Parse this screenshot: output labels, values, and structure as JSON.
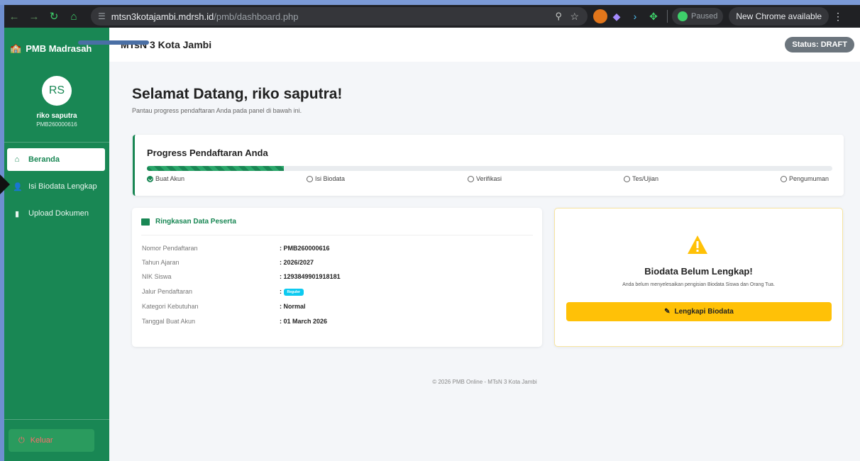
{
  "browser": {
    "url_host": "mtsn3kotajambi.mdrsh.id",
    "url_path": "/pmb/dashboard.php",
    "paused_label": "Paused",
    "update_label": "New Chrome available"
  },
  "sidebar": {
    "brand": "PMB Madrasah",
    "avatar_initials": "RS",
    "user_name": "riko saputra",
    "user_code": "PMB260000616",
    "items": [
      {
        "label": "Beranda",
        "active": true
      },
      {
        "label": "Isi Biodata Lengkap",
        "active": false
      },
      {
        "label": "Upload Dokumen",
        "active": false
      }
    ],
    "logout": "Keluar"
  },
  "header": {
    "title": "MTsN 3 Kota Jambi",
    "status": "Status: DRAFT"
  },
  "welcome": {
    "title": "Selamat Datang, riko saputra!",
    "subtitle": "Pantau progress pendaftaran Anda pada panel di bawah ini."
  },
  "progress": {
    "title": "Progress Pendaftaran Anda",
    "fraction": 0.2,
    "steps": [
      {
        "label": "Buat Akun",
        "done": true
      },
      {
        "label": "Isi Biodata",
        "done": false
      },
      {
        "label": "Verifikasi",
        "done": false
      },
      {
        "label": "Tes/Ujian",
        "done": false
      },
      {
        "label": "Pengumuman",
        "done": false
      }
    ]
  },
  "summary": {
    "title": "Ringkasan Data Peserta",
    "rows": [
      {
        "label": "Nomor Pendaftaran",
        "value": ": PMB260000616"
      },
      {
        "label": "Tahun Ajaran",
        "value": ": 2026/2027"
      },
      {
        "label": "NIK Siswa",
        "value": ": 1293849901918181"
      },
      {
        "label": "Jalur Pendaftaran",
        "value": ":",
        "badge": "Reguler"
      },
      {
        "label": "Kategori Kebutuhan",
        "value": ": Normal"
      },
      {
        "label": "Tanggal Buat Akun",
        "value": ": 01 March 2026"
      }
    ]
  },
  "warning": {
    "title": "Biodata Belum Lengkap!",
    "text": "Anda belum menyelesaikan pengisian Biodata Siswa dan Orang Tua.",
    "button": "Lengkapi Biodata"
  },
  "footer": "© 2026 PMB Online - MTsN 3 Kota Jambi",
  "colors": {
    "primary": "#198754",
    "warning": "#ffc107",
    "status_badge": "#6c757d",
    "info_badge": "#0dcaf0"
  }
}
